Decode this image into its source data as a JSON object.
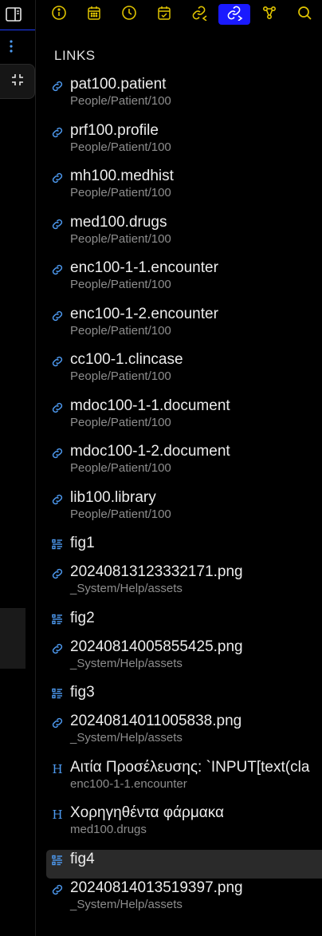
{
  "panel": {
    "title": "LINKS"
  },
  "colors": {
    "accent": "#1a1aff",
    "icon": "#4e9bf2",
    "active_toolbar_icon": "#ffffff"
  },
  "toolbar": {
    "buttons": [
      {
        "name": "info-icon",
        "active": false
      },
      {
        "name": "calendar-icon",
        "active": false
      },
      {
        "name": "clock-icon",
        "active": false
      },
      {
        "name": "calendar-check-icon",
        "active": false
      },
      {
        "name": "backlinks-icon",
        "active": false
      },
      {
        "name": "outgoing-links-icon",
        "active": true
      },
      {
        "name": "graph-icon",
        "active": false
      },
      {
        "name": "search-icon",
        "active": false
      }
    ]
  },
  "items": [
    {
      "type": "link",
      "title": "pat100.patient",
      "path": "People/Patient/100"
    },
    {
      "type": "link",
      "title": "prf100.profile",
      "path": "People/Patient/100"
    },
    {
      "type": "link",
      "title": "mh100.medhist",
      "path": "People/Patient/100"
    },
    {
      "type": "link",
      "title": "med100.drugs",
      "path": "People/Patient/100"
    },
    {
      "type": "link",
      "title": "enc100-1-1.encounter",
      "path": "People/Patient/100"
    },
    {
      "type": "link",
      "title": "enc100-1-2.encounter",
      "path": "People/Patient/100"
    },
    {
      "type": "link",
      "title": "cc100-1.clincase",
      "path": "People/Patient/100"
    },
    {
      "type": "link",
      "title": "mdoc100-1-1.document",
      "path": "People/Patient/100"
    },
    {
      "type": "link",
      "title": "mdoc100-1-2.document",
      "path": "People/Patient/100"
    },
    {
      "type": "link",
      "title": "lib100.library",
      "path": "People/Patient/100"
    },
    {
      "type": "block",
      "title": "fig1"
    },
    {
      "type": "link",
      "title": "20240813123332171.png",
      "path": "_System/Help/assets"
    },
    {
      "type": "block",
      "title": "fig2"
    },
    {
      "type": "link",
      "title": "20240814005855425.png",
      "path": "_System/Help/assets"
    },
    {
      "type": "block",
      "title": "fig3"
    },
    {
      "type": "link",
      "title": "20240814011005838.png",
      "path": "_System/Help/assets"
    },
    {
      "type": "heading",
      "title": "Αιτία Προσέλευσης: `INPUT[text(cla",
      "path": "enc100-1-1.encounter"
    },
    {
      "type": "heading",
      "title": "Χορηγηθέντα φάρμακα",
      "path": "med100.drugs"
    },
    {
      "type": "block",
      "title": "fig4",
      "selected": true
    },
    {
      "type": "link",
      "title": "20240814013519397.png",
      "path": "_System/Help/assets"
    }
  ]
}
